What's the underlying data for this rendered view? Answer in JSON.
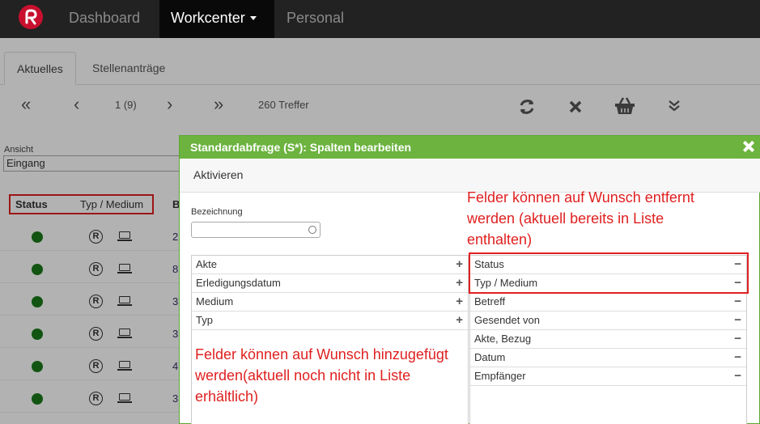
{
  "navbar": {
    "items": [
      {
        "label": "Dashboard"
      },
      {
        "label": "Workcenter"
      },
      {
        "label": "Personal"
      }
    ]
  },
  "background": {
    "tabs": [
      "Aktuelles",
      "Stellenanträge"
    ],
    "pager": {
      "page": "1 (9)",
      "hits": "260 Treffer"
    },
    "ansicht_label": "Ansicht",
    "ansicht_value": "Eingang",
    "columns": [
      "Status",
      "Typ / Medium",
      "B"
    ],
    "row_fragments": [
      "2",
      "8",
      "3",
      "3",
      "4",
      "3"
    ],
    "status_color": "#1a7a1a"
  },
  "modal": {
    "title": "Standardabfrage (S*): Spalten bearbeiten",
    "activate_label": "Aktivieren",
    "bezeichnung_label": "Bezeichnung",
    "bezeichnung_value": "",
    "available_fields": [
      "Akte",
      "Erledigungsdatum",
      "Medium",
      "Typ"
    ],
    "selected_fields": [
      "Status",
      "Typ / Medium",
      "Betreff",
      "Gesendet von",
      "Akte, Bezug",
      "Datum",
      "Empfänger"
    ],
    "add_symbol": "+",
    "remove_symbol": "−"
  },
  "annotations": {
    "right_note": [
      "Felder können auf Wunsch entfernt",
      "werden (aktuell bereits in Liste",
      "enthalten)"
    ],
    "left_note": [
      "Felder können auf Wunsch hinzugefügt",
      "werden(aktuell noch nicht in Liste",
      "erhältlich)"
    ]
  },
  "colors": {
    "accent_green": "#6cb33f",
    "annotation_red": "#e02020",
    "navbar": "#222222"
  }
}
